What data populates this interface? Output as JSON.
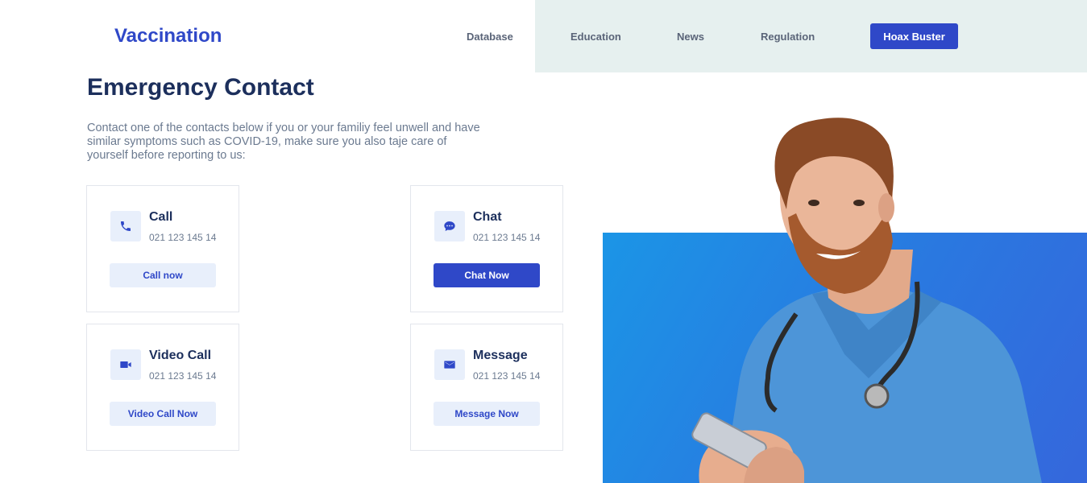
{
  "header": {
    "logo": "Vaccination",
    "nav": [
      "Database",
      "Education",
      "News",
      "Regulation"
    ],
    "cta": "Hoax Buster"
  },
  "main": {
    "title": "Emergency Contact",
    "description": "Contact one of the contacts below if you or your familiy feel unwell and have similar symptoms such as COVID-19, make sure you also taje care of yourself before reporting to us:",
    "cards": [
      {
        "title": "Call",
        "number": "021 123 145 14",
        "button": "Call now",
        "icon": "phone-icon"
      },
      {
        "title": "Chat",
        "number": "021 123 145 14",
        "button": "Chat Now",
        "icon": "chat-icon"
      },
      {
        "title": "Video Call",
        "number": "021 123 145 14",
        "button": "Video Call Now",
        "icon": "video-icon"
      },
      {
        "title": "Message",
        "number": "021 123 145 14",
        "button": "Message Now",
        "icon": "mail-icon"
      }
    ]
  },
  "colors": {
    "accent": "#2f48c8",
    "title": "#1c2f5c",
    "band": "#e6f0ef",
    "hero_blue": "#1b95e6"
  }
}
